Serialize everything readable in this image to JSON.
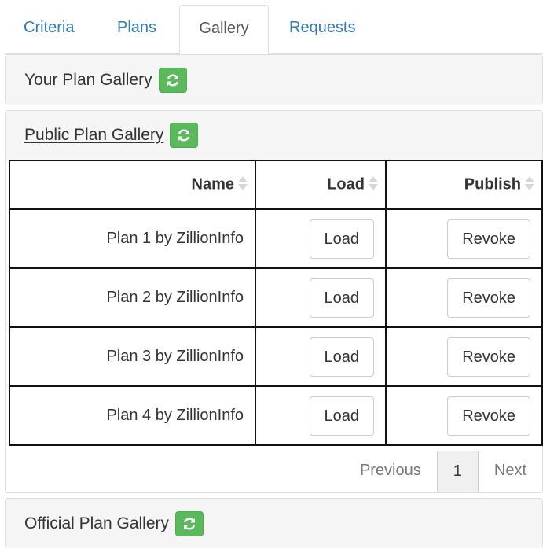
{
  "tabs": [
    {
      "label": "Criteria"
    },
    {
      "label": "Plans"
    },
    {
      "label": "Gallery"
    },
    {
      "label": "Requests"
    }
  ],
  "active_tab": "Gallery",
  "your_gallery": {
    "title": "Your Plan Gallery",
    "refresh_icon": "refresh-icon"
  },
  "public_gallery": {
    "title": "Public Plan Gallery",
    "refresh_icon": "refresh-icon",
    "columns": [
      "Name",
      "Load",
      "Publish"
    ],
    "rows": [
      {
        "name": "Plan 1 by ZillionInfo",
        "load": "Load",
        "publish": "Revoke"
      },
      {
        "name": "Plan 2 by ZillionInfo",
        "load": "Load",
        "publish": "Revoke"
      },
      {
        "name": "Plan 3 by ZillionInfo",
        "load": "Load",
        "publish": "Revoke"
      },
      {
        "name": "Plan 4 by ZillionInfo",
        "load": "Load",
        "publish": "Revoke"
      }
    ],
    "pagination": {
      "previous": "Previous",
      "current": "1",
      "next": "Next"
    }
  },
  "official_gallery": {
    "title": "Official Plan Gallery",
    "refresh_icon": "refresh-icon"
  },
  "colors": {
    "accent": "#337ab7",
    "refresh_bg": "#5cb85c"
  }
}
